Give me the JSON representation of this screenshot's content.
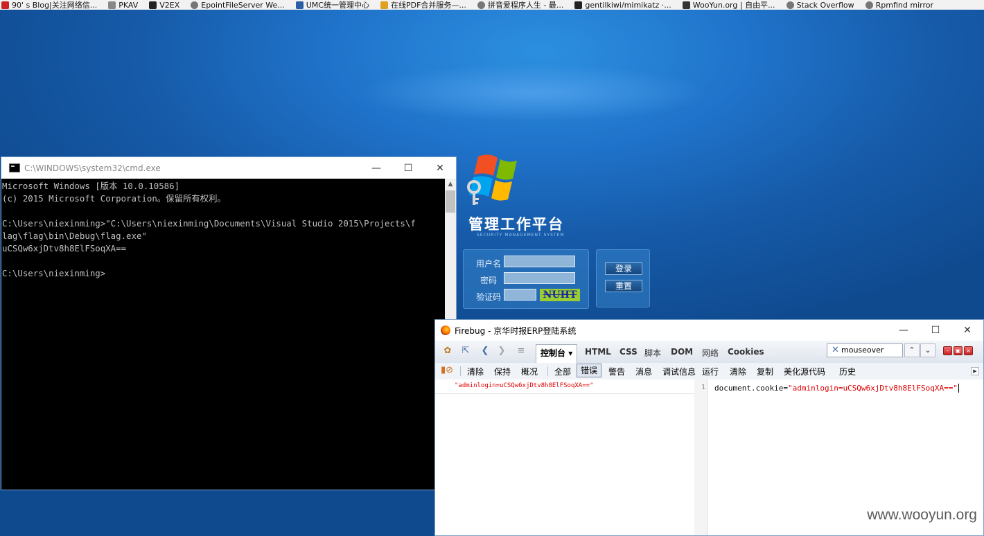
{
  "bookmarks": [
    {
      "label": "90' s Blog|关注网络信...",
      "icon": "site-icon",
      "color": "#cc2222"
    },
    {
      "label": "PKAV",
      "icon": "site-icon",
      "color": "#888888"
    },
    {
      "label": "V2EX",
      "icon": "site-icon",
      "color": "#222222"
    },
    {
      "label": "EpointFileServer We...",
      "icon": "globe-icon",
      "color": "#777777"
    },
    {
      "label": "UMC统一管理中心",
      "icon": "site-icon",
      "color": "#2a5fa8"
    },
    {
      "label": "在线PDF合并服务—...",
      "icon": "site-icon",
      "color": "#e0a020"
    },
    {
      "label": "拼音爱程序人生 - 最...",
      "icon": "globe-icon",
      "color": "#777777"
    },
    {
      "label": "gentilkiwi/mimikatz ·...",
      "icon": "github-icon",
      "color": "#222222"
    },
    {
      "label": "WooYun.org | 自由平...",
      "icon": "site-icon",
      "color": "#333333"
    },
    {
      "label": "Stack Overflow",
      "icon": "globe-icon",
      "color": "#777777"
    },
    {
      "label": "Rpmfind mirror",
      "icon": "globe-icon",
      "color": "#777777"
    }
  ],
  "login": {
    "title": "管理工作平台",
    "subtitle": "SECURITY MANAGEMENT SYSTEM",
    "username_label": "用户名",
    "password_label": "密码",
    "captcha_label": "验证码",
    "captcha_text": "NUHT",
    "login_button": "登录",
    "reset_button": "重置"
  },
  "cmd": {
    "title": "C:\\WINDOWS\\system32\\cmd.exe",
    "lines": [
      "Microsoft Windows [版本 10.0.10586]",
      "(c) 2015 Microsoft Corporation。保留所有权利。",
      "",
      "C:\\Users\\niexinming>\"C:\\Users\\niexinming\\Documents\\Visual Studio 2015\\Projects\\f",
      "lag\\flag\\bin\\Debug\\flag.exe\"",
      "uCSQw6xjDtv8h8ElFSoqXA==",
      "",
      "C:\\Users\\niexinming>"
    ]
  },
  "firebug": {
    "title": "Firebug - 京华时报ERP登陆系统",
    "tabs": [
      "控制台",
      "HTML",
      "CSS",
      "脚本",
      "DOM",
      "网络",
      "Cookies"
    ],
    "search_value": "mouseover",
    "subtoolbar": [
      "清除",
      "保持",
      "概况",
      "全部",
      "错误",
      "警告",
      "消息",
      "调试信息",
      "运行",
      "清除",
      "复制",
      "美化源代码",
      "历史"
    ],
    "console_output": "\"adminlogin=uCSQw6xjDtv8h8ElFSoqXA==\"",
    "line_number": "1",
    "code_prefix": "document.cookie=",
    "code_string": "\"adminlogin=uCSQw6xjDtv8h8ElFSoqXA==\""
  },
  "watermark": "www.wooyun.org"
}
